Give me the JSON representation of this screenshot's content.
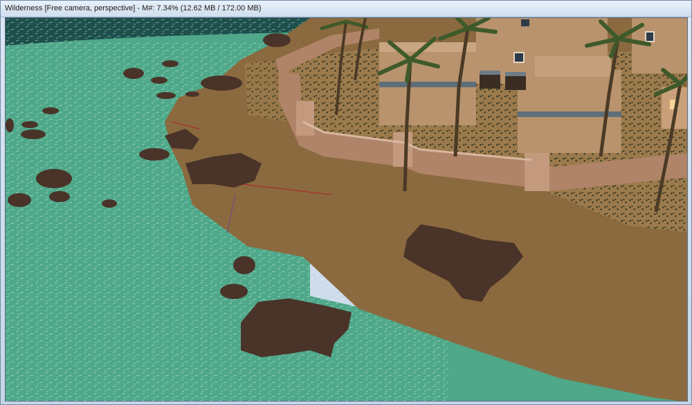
{
  "window": {
    "title": "Wilderness [Free camera, perspective] - M#: 7.34% (12.62 MB / 172.00 MB)"
  },
  "scene": {
    "camera_mode": "Free camera",
    "projection": "perspective",
    "memory_percent": "7.34%",
    "memory_used": "12.62 MB",
    "memory_total": "172.00 MB",
    "colors": {
      "deep_water": "#1d4f4c",
      "shallow_water": "#4ea889",
      "sand": "#8b6a3f",
      "wall": "#b08468",
      "building": "#b9936d",
      "rock": "#4a3328",
      "palm_leaf": "#3f5a2a",
      "trunk": "#4a3a26"
    }
  }
}
